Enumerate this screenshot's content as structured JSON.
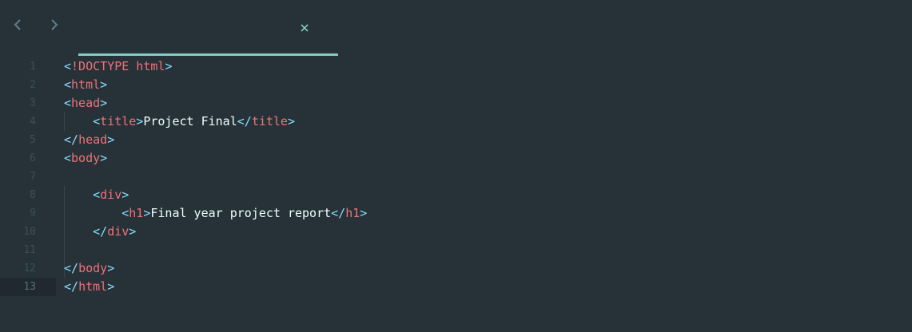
{
  "theme": {
    "background": "#263238",
    "tab_underline": "#80cbc4",
    "tag_color": "#f07178",
    "punct_color": "#89ddff",
    "text_color": "#eeffff",
    "gutter_color": "#3b4f57"
  },
  "tabbar": {
    "back_icon": "chevron-left-icon",
    "forward_icon": "chevron-right-icon",
    "close_icon": "close-icon",
    "active_tab_title": ""
  },
  "editor": {
    "active_line": 13,
    "lines": [
      {
        "num": "1",
        "indent": "",
        "tokens": [
          {
            "t": "punct",
            "v": "<"
          },
          {
            "t": "tag",
            "v": "!DOCTYPE html"
          },
          {
            "t": "punct",
            "v": ">"
          }
        ]
      },
      {
        "num": "2",
        "indent": "",
        "tokens": [
          {
            "t": "punct",
            "v": "<"
          },
          {
            "t": "tag",
            "v": "html"
          },
          {
            "t": "punct",
            "v": ">"
          }
        ]
      },
      {
        "num": "3",
        "indent": "",
        "tokens": [
          {
            "t": "punct",
            "v": "<"
          },
          {
            "t": "tag",
            "v": "head"
          },
          {
            "t": "punct",
            "v": ">"
          }
        ]
      },
      {
        "num": "4",
        "indent": "    ",
        "tokens": [
          {
            "t": "punct",
            "v": "<"
          },
          {
            "t": "tag",
            "v": "title"
          },
          {
            "t": "punct",
            "v": ">"
          },
          {
            "t": "text",
            "v": "Project Final"
          },
          {
            "t": "punct",
            "v": "</"
          },
          {
            "t": "tag",
            "v": "title"
          },
          {
            "t": "punct",
            "v": ">"
          }
        ]
      },
      {
        "num": "5",
        "indent": "",
        "tokens": [
          {
            "t": "punct",
            "v": "</"
          },
          {
            "t": "tag",
            "v": "head"
          },
          {
            "t": "punct",
            "v": ">"
          }
        ]
      },
      {
        "num": "6",
        "indent": "",
        "tokens": [
          {
            "t": "punct",
            "v": "<"
          },
          {
            "t": "tag",
            "v": "body"
          },
          {
            "t": "punct",
            "v": ">"
          }
        ]
      },
      {
        "num": "7",
        "indent": "",
        "tokens": []
      },
      {
        "num": "8",
        "indent": "    ",
        "tokens": [
          {
            "t": "punct",
            "v": "<"
          },
          {
            "t": "tag",
            "v": "div"
          },
          {
            "t": "punct",
            "v": ">"
          }
        ]
      },
      {
        "num": "9",
        "indent": "        ",
        "tokens": [
          {
            "t": "punct",
            "v": "<"
          },
          {
            "t": "tag",
            "v": "h1"
          },
          {
            "t": "punct",
            "v": ">"
          },
          {
            "t": "text",
            "v": "Final year project report"
          },
          {
            "t": "punct",
            "v": "</"
          },
          {
            "t": "tag",
            "v": "h1"
          },
          {
            "t": "punct",
            "v": ">"
          }
        ]
      },
      {
        "num": "10",
        "indent": "    ",
        "tokens": [
          {
            "t": "punct",
            "v": "</"
          },
          {
            "t": "tag",
            "v": "div"
          },
          {
            "t": "punct",
            "v": ">"
          }
        ]
      },
      {
        "num": "11",
        "indent": "",
        "tokens": []
      },
      {
        "num": "12",
        "indent": "",
        "tokens": [
          {
            "t": "punct",
            "v": "</"
          },
          {
            "t": "tag",
            "v": "body"
          },
          {
            "t": "punct",
            "v": ">"
          }
        ]
      },
      {
        "num": "13",
        "indent": "",
        "tokens": [
          {
            "t": "punct",
            "v": "</"
          },
          {
            "t": "tag",
            "v": "html"
          },
          {
            "t": "punct",
            "v": ">"
          }
        ]
      }
    ]
  }
}
